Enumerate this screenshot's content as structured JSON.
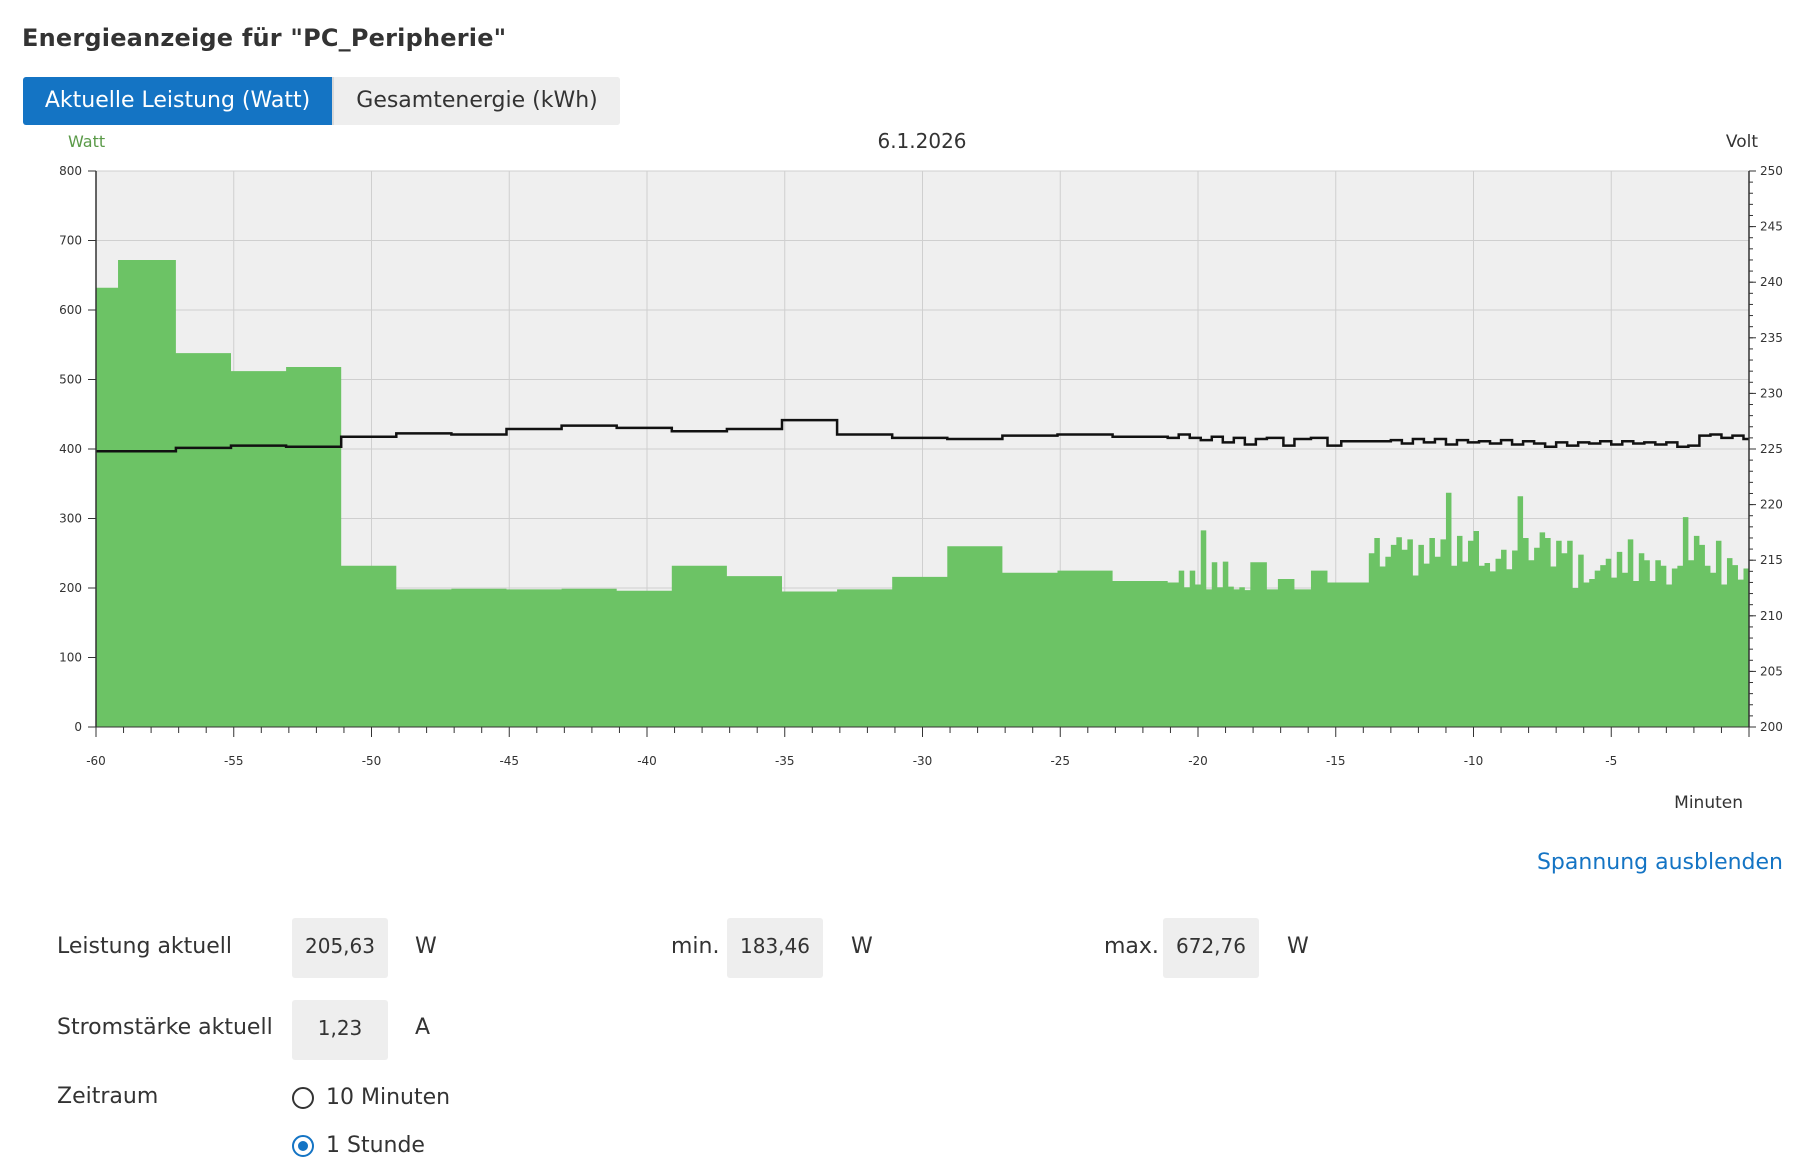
{
  "page": {
    "title": "Energieanzeige für \"PC_Peripherie\""
  },
  "tabs": [
    {
      "label": "Aktuelle Leistung (Watt)",
      "active": true
    },
    {
      "label": "Gesamtenergie (kWh)",
      "active": false
    }
  ],
  "colors": {
    "accent": "#1474c4",
    "power_fill": "#6cc365",
    "voltage_line": "#111111",
    "plot_bg": "#efefef",
    "watt_axis_label": "#5a9a48"
  },
  "chart_data": {
    "type": "area",
    "title": "6.1.2026",
    "xlabel": "Minuten",
    "ylabel": "Watt",
    "y2label": "Volt",
    "xlim": [
      -60,
      0
    ],
    "ylim": [
      0,
      800
    ],
    "y2lim": [
      200,
      250
    ],
    "x_ticks": [
      "-60",
      "-55",
      "-50",
      "-45",
      "-40",
      "-35",
      "-30",
      "-25",
      "-20",
      "-15",
      "-10",
      "-5"
    ],
    "y_ticks": [
      "0",
      "100",
      "200",
      "300",
      "400",
      "500",
      "600",
      "700",
      "800"
    ],
    "y2_ticks": [
      "200",
      "205",
      "210",
      "215",
      "220",
      "225",
      "230",
      "235",
      "240",
      "245",
      "250"
    ],
    "grid": true,
    "series": [
      {
        "name": "Watt",
        "style": "step-area",
        "points": [
          [
            -60,
            632
          ],
          [
            -59.2,
            672
          ],
          [
            -57.1,
            538
          ],
          [
            -55.1,
            512
          ],
          [
            -53.1,
            518
          ],
          [
            -51.1,
            232
          ],
          [
            -49.1,
            198
          ],
          [
            -47.1,
            199
          ],
          [
            -45.1,
            198
          ],
          [
            -43.1,
            199
          ],
          [
            -41.1,
            196
          ],
          [
            -39.1,
            232
          ],
          [
            -37.1,
            217
          ],
          [
            -35.1,
            195
          ],
          [
            -33.1,
            198
          ],
          [
            -31.1,
            216
          ],
          [
            -29.1,
            260
          ],
          [
            -27.1,
            222
          ],
          [
            -25.1,
            225
          ],
          [
            -23.1,
            210
          ],
          [
            -21.1,
            208
          ],
          [
            -20.7,
            225
          ],
          [
            -20.5,
            201
          ],
          [
            -20.3,
            225
          ],
          [
            -20.1,
            205
          ],
          [
            -19.9,
            283
          ],
          [
            -19.7,
            198
          ],
          [
            -19.5,
            237
          ],
          [
            -19.3,
            201
          ],
          [
            -19.1,
            238
          ],
          [
            -18.9,
            202
          ],
          [
            -18.7,
            198
          ],
          [
            -18.5,
            201
          ],
          [
            -18.3,
            197
          ],
          [
            -18.1,
            237
          ],
          [
            -17.5,
            198
          ],
          [
            -17.1,
            213
          ],
          [
            -16.5,
            198
          ],
          [
            -15.9,
            225
          ],
          [
            -15.3,
            208
          ],
          [
            -13.8,
            250
          ],
          [
            -13.6,
            272
          ],
          [
            -13.4,
            231
          ],
          [
            -13.2,
            245
          ],
          [
            -13.0,
            262
          ],
          [
            -12.8,
            273
          ],
          [
            -12.6,
            255
          ],
          [
            -12.4,
            270
          ],
          [
            -12.2,
            218
          ],
          [
            -12.0,
            262
          ],
          [
            -11.8,
            235
          ],
          [
            -11.6,
            272
          ],
          [
            -11.4,
            245
          ],
          [
            -11.2,
            270
          ],
          [
            -11.0,
            337
          ],
          [
            -10.8,
            232
          ],
          [
            -10.6,
            275
          ],
          [
            -10.4,
            238
          ],
          [
            -10.2,
            268
          ],
          [
            -10.0,
            282
          ],
          [
            -9.8,
            232
          ],
          [
            -9.6,
            236
          ],
          [
            -9.4,
            224
          ],
          [
            -9.2,
            242
          ],
          [
            -9.0,
            255
          ],
          [
            -8.8,
            227
          ],
          [
            -8.6,
            254
          ],
          [
            -8.4,
            332
          ],
          [
            -8.2,
            272
          ],
          [
            -8.0,
            240
          ],
          [
            -7.8,
            258
          ],
          [
            -7.6,
            280
          ],
          [
            -7.4,
            272
          ],
          [
            -7.2,
            231
          ],
          [
            -7.0,
            268
          ],
          [
            -6.8,
            250
          ],
          [
            -6.6,
            268
          ],
          [
            -6.4,
            200
          ],
          [
            -6.2,
            248
          ],
          [
            -6.0,
            208
          ],
          [
            -5.8,
            213
          ],
          [
            -5.6,
            225
          ],
          [
            -5.4,
            233
          ],
          [
            -5.2,
            242
          ],
          [
            -5.0,
            215
          ],
          [
            -4.8,
            252
          ],
          [
            -4.6,
            222
          ],
          [
            -4.4,
            270
          ],
          [
            -4.2,
            210
          ],
          [
            -4.0,
            250
          ],
          [
            -3.8,
            240
          ],
          [
            -3.6,
            210
          ],
          [
            -3.4,
            240
          ],
          [
            -3.2,
            232
          ],
          [
            -3.0,
            205
          ],
          [
            -2.8,
            228
          ],
          [
            -2.6,
            232
          ],
          [
            -2.4,
            302
          ],
          [
            -2.2,
            240
          ],
          [
            -2.0,
            275
          ],
          [
            -1.8,
            262
          ],
          [
            -1.6,
            232
          ],
          [
            -1.4,
            222
          ],
          [
            -1.2,
            268
          ],
          [
            -1.0,
            205
          ],
          [
            -0.8,
            243
          ],
          [
            -0.6,
            233
          ],
          [
            -0.4,
            212
          ],
          [
            -0.2,
            228
          ],
          [
            0,
            228
          ]
        ]
      },
      {
        "name": "Volt",
        "style": "step-line",
        "axis": "right",
        "points": [
          [
            -60,
            224.8
          ],
          [
            -57.1,
            225.1
          ],
          [
            -55.1,
            225.3
          ],
          [
            -53.1,
            225.2
          ],
          [
            -51.1,
            226.1
          ],
          [
            -49.1,
            226.4
          ],
          [
            -47.1,
            226.3
          ],
          [
            -45.1,
            226.8
          ],
          [
            -43.1,
            227.1
          ],
          [
            -41.1,
            226.9
          ],
          [
            -39.1,
            226.6
          ],
          [
            -37.1,
            226.8
          ],
          [
            -35.1,
            227.6
          ],
          [
            -33.1,
            226.3
          ],
          [
            -31.1,
            226.0
          ],
          [
            -29.1,
            225.9
          ],
          [
            -27.1,
            226.2
          ],
          [
            -25.1,
            226.3
          ],
          [
            -23.1,
            226.1
          ],
          [
            -21.1,
            226.0
          ],
          [
            -20.7,
            226.3
          ],
          [
            -20.3,
            226.0
          ],
          [
            -19.9,
            225.8
          ],
          [
            -19.5,
            226.1
          ],
          [
            -19.1,
            225.6
          ],
          [
            -18.7,
            226.0
          ],
          [
            -18.3,
            225.4
          ],
          [
            -17.9,
            225.9
          ],
          [
            -17.5,
            226.0
          ],
          [
            -16.9,
            225.3
          ],
          [
            -16.5,
            225.9
          ],
          [
            -15.9,
            226.0
          ],
          [
            -15.3,
            225.3
          ],
          [
            -14.8,
            225.7
          ],
          [
            -13.0,
            225.8
          ],
          [
            -12.6,
            225.5
          ],
          [
            -12.2,
            225.9
          ],
          [
            -11.8,
            225.6
          ],
          [
            -11.4,
            225.9
          ],
          [
            -11.0,
            225.4
          ],
          [
            -10.6,
            225.8
          ],
          [
            -10.2,
            225.6
          ],
          [
            -9.8,
            225.7
          ],
          [
            -9.4,
            225.5
          ],
          [
            -9.0,
            225.8
          ],
          [
            -8.6,
            225.4
          ],
          [
            -8.2,
            225.7
          ],
          [
            -7.8,
            225.5
          ],
          [
            -7.4,
            225.2
          ],
          [
            -7.0,
            225.6
          ],
          [
            -6.6,
            225.3
          ],
          [
            -6.2,
            225.6
          ],
          [
            -5.8,
            225.5
          ],
          [
            -5.4,
            225.7
          ],
          [
            -5.0,
            225.4
          ],
          [
            -4.6,
            225.7
          ],
          [
            -4.2,
            225.5
          ],
          [
            -3.8,
            225.6
          ],
          [
            -3.4,
            225.4
          ],
          [
            -3.0,
            225.6
          ],
          [
            -2.6,
            225.2
          ],
          [
            -2.2,
            225.3
          ],
          [
            -1.8,
            226.2
          ],
          [
            -1.4,
            226.3
          ],
          [
            -1.0,
            226.0
          ],
          [
            -0.6,
            226.2
          ],
          [
            -0.2,
            225.9
          ],
          [
            0,
            225.9
          ]
        ]
      }
    ]
  },
  "controls": {
    "toggle_voltage_label": "Spannung ausblenden"
  },
  "stats": {
    "power_label": "Leistung aktuell",
    "power_value": "205,63",
    "power_unit": "W",
    "min_label": "min.",
    "min_value": "183,46",
    "min_unit": "W",
    "max_label": "max.",
    "max_value": "672,76",
    "max_unit": "W",
    "current_label": "Stromstärke aktuell",
    "current_value": "1,23",
    "current_unit": "A"
  },
  "period": {
    "label": "Zeitraum",
    "options": [
      {
        "label": "10 Minuten",
        "selected": false
      },
      {
        "label": "1 Stunde",
        "selected": true
      }
    ]
  }
}
